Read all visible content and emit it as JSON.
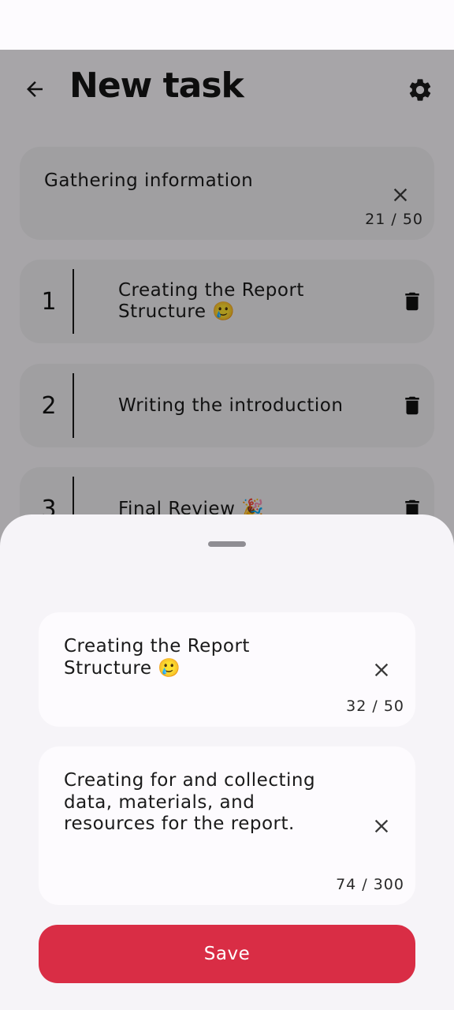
{
  "header": {
    "title": "New task"
  },
  "task_title": {
    "value": "Gathering information",
    "counter": "21 / 50"
  },
  "steps": [
    {
      "number": "1",
      "text": "Creating the Report Structure 🥲"
    },
    {
      "number": "2",
      "text": "Writing the introduction"
    },
    {
      "number": "3",
      "text": "Final Review 🎉"
    }
  ],
  "sheet": {
    "step_name": {
      "value": "Creating the Report\nStructure 🥲",
      "counter": "32 / 50"
    },
    "step_description": {
      "value": "Creating for and collecting\ndata, materials, and\nresources for the report.",
      "counter": "74 / 300"
    },
    "save_label": "Save"
  },
  "colors": {
    "accent": "#d92d45",
    "card": "#eceaee",
    "background": "#f6f4f8"
  },
  "icons": [
    "back-arrow-icon",
    "gear-icon",
    "close-icon",
    "trash-icon",
    "drag-handle"
  ]
}
